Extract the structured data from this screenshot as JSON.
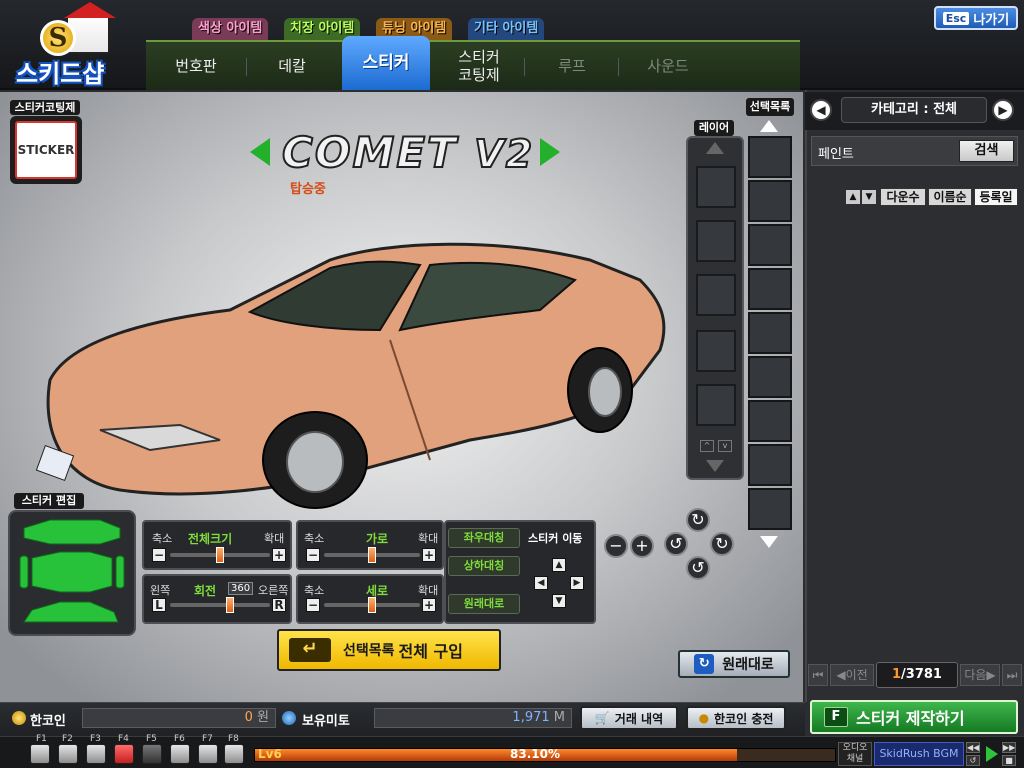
{
  "logo": {
    "badge": "S",
    "name": "스키드샵"
  },
  "category_tabs": [
    {
      "label": "색상 아이템",
      "bg": "#7a3b59",
      "color": "#ff9fcf"
    },
    {
      "label": "치장 아이템",
      "bg": "#3d6a24",
      "color": "#b7ff5a"
    },
    {
      "label": "튜닝 아이템",
      "bg": "#8a5a16",
      "color": "#ffb54a"
    },
    {
      "label": "기타 아이템",
      "bg": "#24487d",
      "color": "#7ac2ff"
    }
  ],
  "main_tabs": [
    {
      "label": "번호판"
    },
    {
      "label": "데칼"
    },
    {
      "label": "스티커"
    },
    {
      "label": "스티커\n코팅제"
    },
    {
      "label": "루프"
    },
    {
      "label": "사운드"
    }
  ],
  "esc": {
    "key": "Esc",
    "label": "나가기"
  },
  "coating": {
    "label": "스티커코팅제",
    "sticker_text": "STICKER"
  },
  "car": {
    "name": "COMET",
    "version": "V2",
    "status": "탑승중",
    "body_color": "#e0a17c"
  },
  "layer": {
    "label": "레이어"
  },
  "selection": {
    "label": "선택목록"
  },
  "sticker_edit": {
    "label": "스티커 편집",
    "size": {
      "shrink": "축소",
      "title": "전체크기",
      "enlarge": "확대",
      "value": 0.5
    },
    "width": {
      "shrink": "축소",
      "title": "가로",
      "enlarge": "확대",
      "value": 0.5
    },
    "rotate": {
      "left": "왼쪽",
      "title": "회전",
      "degree": "360",
      "right": "오른쪽",
      "value": 0.6
    },
    "height": {
      "shrink": "축소",
      "title": "세로",
      "enlarge": "확대",
      "value": 0.5
    },
    "mirror_h": "좌우대칭",
    "mirror_v": "상하대칭",
    "restore": "원래대로",
    "move_label": "스티커 이동"
  },
  "buy_button": {
    "prefix": "선택목록",
    "label": "전체 구입"
  },
  "reset_button": {
    "label": "원래대로"
  },
  "right_panel": {
    "category": "카테고리 : 전체",
    "search_value": "페인트",
    "search_button": "검색",
    "sort": [
      "다운수",
      "이름순",
      "등록일"
    ],
    "pager": {
      "prev": "이전",
      "next": "다음",
      "current": "1",
      "total": "/3781"
    }
  },
  "make_button": {
    "key": "F",
    "label": "스티커 제작하기"
  },
  "currency": {
    "hancoin_label": "한코인",
    "hancoin_value": "0",
    "hancoin_unit": "원",
    "mito_label": "보유미토",
    "mito_value": "1,971",
    "mito_unit": "M",
    "history_button": "거래 내역",
    "charge_button": "한코인 충전"
  },
  "hotbar": {
    "keys": [
      "F1",
      "F2",
      "F3",
      "F4",
      "F5",
      "F6",
      "F7",
      "F8"
    ],
    "level": "Lv6",
    "xp_percent": "83.10%",
    "xp_value": 0.831,
    "audio_channel": "오디오 채널",
    "bgm": "SkidRush BGM"
  }
}
